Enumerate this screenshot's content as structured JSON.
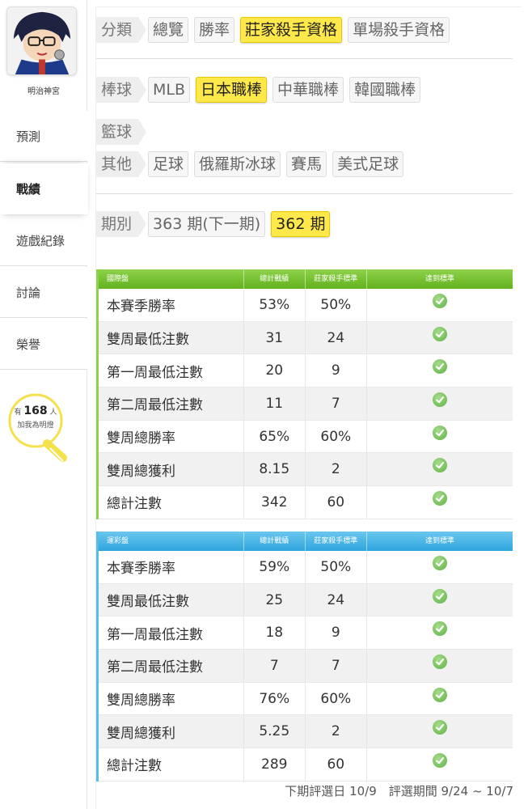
{
  "sidebar": {
    "user_name": "明治神宮",
    "nav": [
      {
        "label": "預測",
        "active": false
      },
      {
        "label": "戰績",
        "active": true
      },
      {
        "label": "遊戲紀錄",
        "active": false
      },
      {
        "label": "討論",
        "active": false
      },
      {
        "label": "榮譽",
        "active": false
      }
    ],
    "bulb": {
      "prefix": "有",
      "count": "168",
      "suffix": "人",
      "line2": "加我為明燈"
    }
  },
  "filters": {
    "category": {
      "label": "分類",
      "options": [
        "總覽",
        "勝率",
        "莊家殺手資格",
        "單場殺手資格"
      ],
      "selected": "莊家殺手資格"
    },
    "baseball": {
      "label": "棒球",
      "options": [
        "MLB",
        "日本職棒",
        "中華職棒",
        "韓國職棒"
      ],
      "selected": "日本職棒"
    },
    "basketball": {
      "label": "籃球",
      "options": []
    },
    "other": {
      "label": "其他",
      "options": [
        "足球",
        "俄羅斯冰球",
        "賽馬",
        "美式足球"
      ]
    },
    "period": {
      "label": "期別",
      "options": [
        "363 期(下一期)",
        "362 期"
      ],
      "selected": "362 期"
    }
  },
  "tables": [
    {
      "title": "國際盤",
      "headers": [
        "總計戰績",
        "莊家殺手標準",
        "達到標準"
      ],
      "rows": [
        {
          "name": "本賽季勝率",
          "total": "53%",
          "standard": "50%"
        },
        {
          "name": "雙周最低注數",
          "total": "31",
          "standard": "24"
        },
        {
          "name": "第一周最低注數",
          "total": "20",
          "standard": "9"
        },
        {
          "name": "第二周最低注數",
          "total": "11",
          "standard": "7"
        },
        {
          "name": "雙周總勝率",
          "total": "65%",
          "standard": "60%"
        },
        {
          "name": "雙周總獲利",
          "total": "8.15",
          "standard": "2"
        },
        {
          "name": "總計注數",
          "total": "342",
          "standard": "60"
        }
      ]
    },
    {
      "title": "運彩盤",
      "headers": [
        "總計戰績",
        "莊家殺手標準",
        "達到標準"
      ],
      "rows": [
        {
          "name": "本賽季勝率",
          "total": "59%",
          "standard": "50%"
        },
        {
          "name": "雙周最低注數",
          "total": "25",
          "standard": "24"
        },
        {
          "name": "第一周最低注數",
          "total": "18",
          "standard": "9"
        },
        {
          "name": "第二周最低注數",
          "total": "7",
          "standard": "7"
        },
        {
          "name": "雙周總勝率",
          "total": "76%",
          "standard": "60%"
        },
        {
          "name": "雙周總獲利",
          "total": "5.25",
          "standard": "2"
        },
        {
          "name": "總計注數",
          "total": "289",
          "standard": "60"
        }
      ]
    }
  ],
  "footer": "下期評選日 10/9　評選期間 9/24 ~ 10/7",
  "colors": {
    "selected_chip": "#ffe84a",
    "green_header": "#62b21e",
    "blue_header": "#2ea6de",
    "check": "#5fb045"
  }
}
